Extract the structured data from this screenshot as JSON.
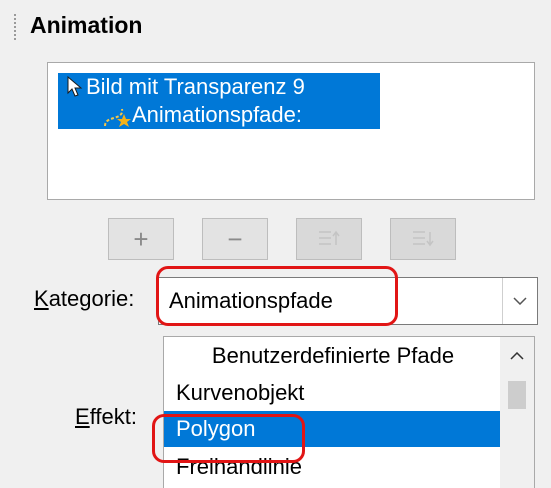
{
  "panel": {
    "title": "Animation"
  },
  "animation_list": {
    "items": [
      {
        "label": "Bild mit Transparenz 9",
        "icon": "cursor-icon"
      },
      {
        "label": "Animationspfade:",
        "icon": "motion-path-icon"
      }
    ],
    "selection_color": "#0078d7"
  },
  "toolbar": {
    "add": "+",
    "remove": "−",
    "move_up_icon": "move-up-icon",
    "move_down_icon": "move-down-icon"
  },
  "kategorie": {
    "label_access": "K",
    "label_rest": "ategorie:",
    "value": "Animationspfade"
  },
  "effekt": {
    "label_access": "E",
    "label_rest": "ffekt:",
    "header": "Benutzerdefinierte Pfade",
    "items": [
      "Kurvenobjekt",
      "Polygon",
      "Freihandlinie"
    ],
    "selected": "Polygon"
  },
  "highlight_color": "#e11515"
}
